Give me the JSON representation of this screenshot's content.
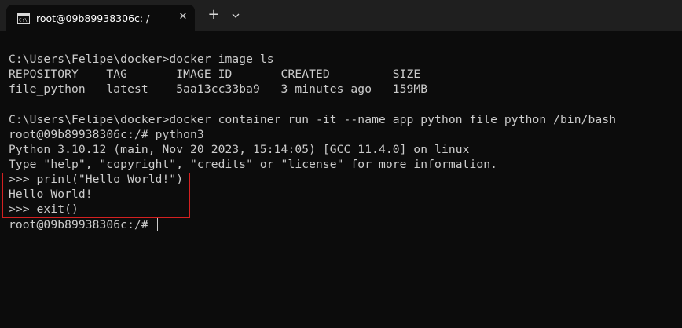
{
  "tab": {
    "title": "root@09b89938306c: /",
    "icon": "terminal-icon",
    "close_glyph": "✕"
  },
  "tabbar": {
    "new_tab_glyph": "+"
  },
  "colors": {
    "background": "#0c0c0c",
    "tabbar": "#1f1f1f",
    "text": "#cccccc",
    "highlight": "#d42020"
  },
  "terminal": {
    "lines": [
      "C:\\Users\\Felipe\\docker>docker image ls",
      "REPOSITORY    TAG       IMAGE ID       CREATED         SIZE",
      "file_python   latest    5aa13cc33ba9   3 minutes ago   159MB",
      "",
      "C:\\Users\\Felipe\\docker>docker container run -it --name app_python file_python /bin/bash",
      "root@09b89938306c:/# python3",
      "Python 3.10.12 (main, Nov 20 2023, 15:14:05) [GCC 11.4.0] on linux",
      "Type \"help\", \"copyright\", \"credits\" or \"license\" for more information.",
      ">>> print(\"Hello World!\")",
      "Hello World!",
      ">>> exit()",
      "root@09b89938306c:/# "
    ]
  }
}
